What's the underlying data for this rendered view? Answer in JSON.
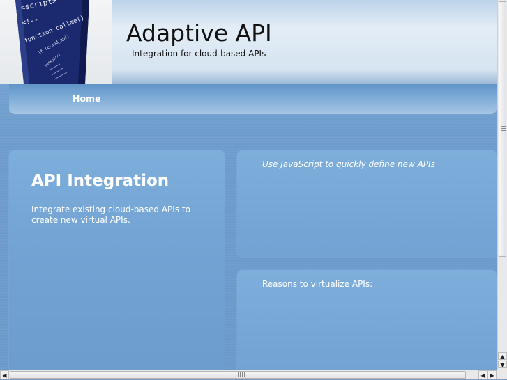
{
  "header": {
    "title": "Adaptive API",
    "tagline": "Integration for cloud-based APIs",
    "logo_icon": "code-script-banner-icon",
    "logo_text": [
      "<script>",
      "<!--",
      "function callme()",
      "if (cloud_api)",
      "getApi(x)"
    ]
  },
  "nav": {
    "items": [
      {
        "label": "Home"
      }
    ]
  },
  "main": {
    "left_card": {
      "heading": "API Integration",
      "body": "Integrate existing cloud-based APIs to create new virtual APIs."
    },
    "right_top_card": {
      "text": "Use JavaScript to quickly define new APIs"
    },
    "right_bottom_card": {
      "text": "Reasons to virtualize APIs:"
    }
  },
  "scrollbars": {
    "up_arrow": "▲",
    "down_arrow": "▼",
    "left_arrow": "◀",
    "right_arrow": "▶"
  },
  "colors": {
    "page_bg": "#6f9ccb",
    "card_bg": "#79a9d8",
    "text": "#ffffff"
  }
}
